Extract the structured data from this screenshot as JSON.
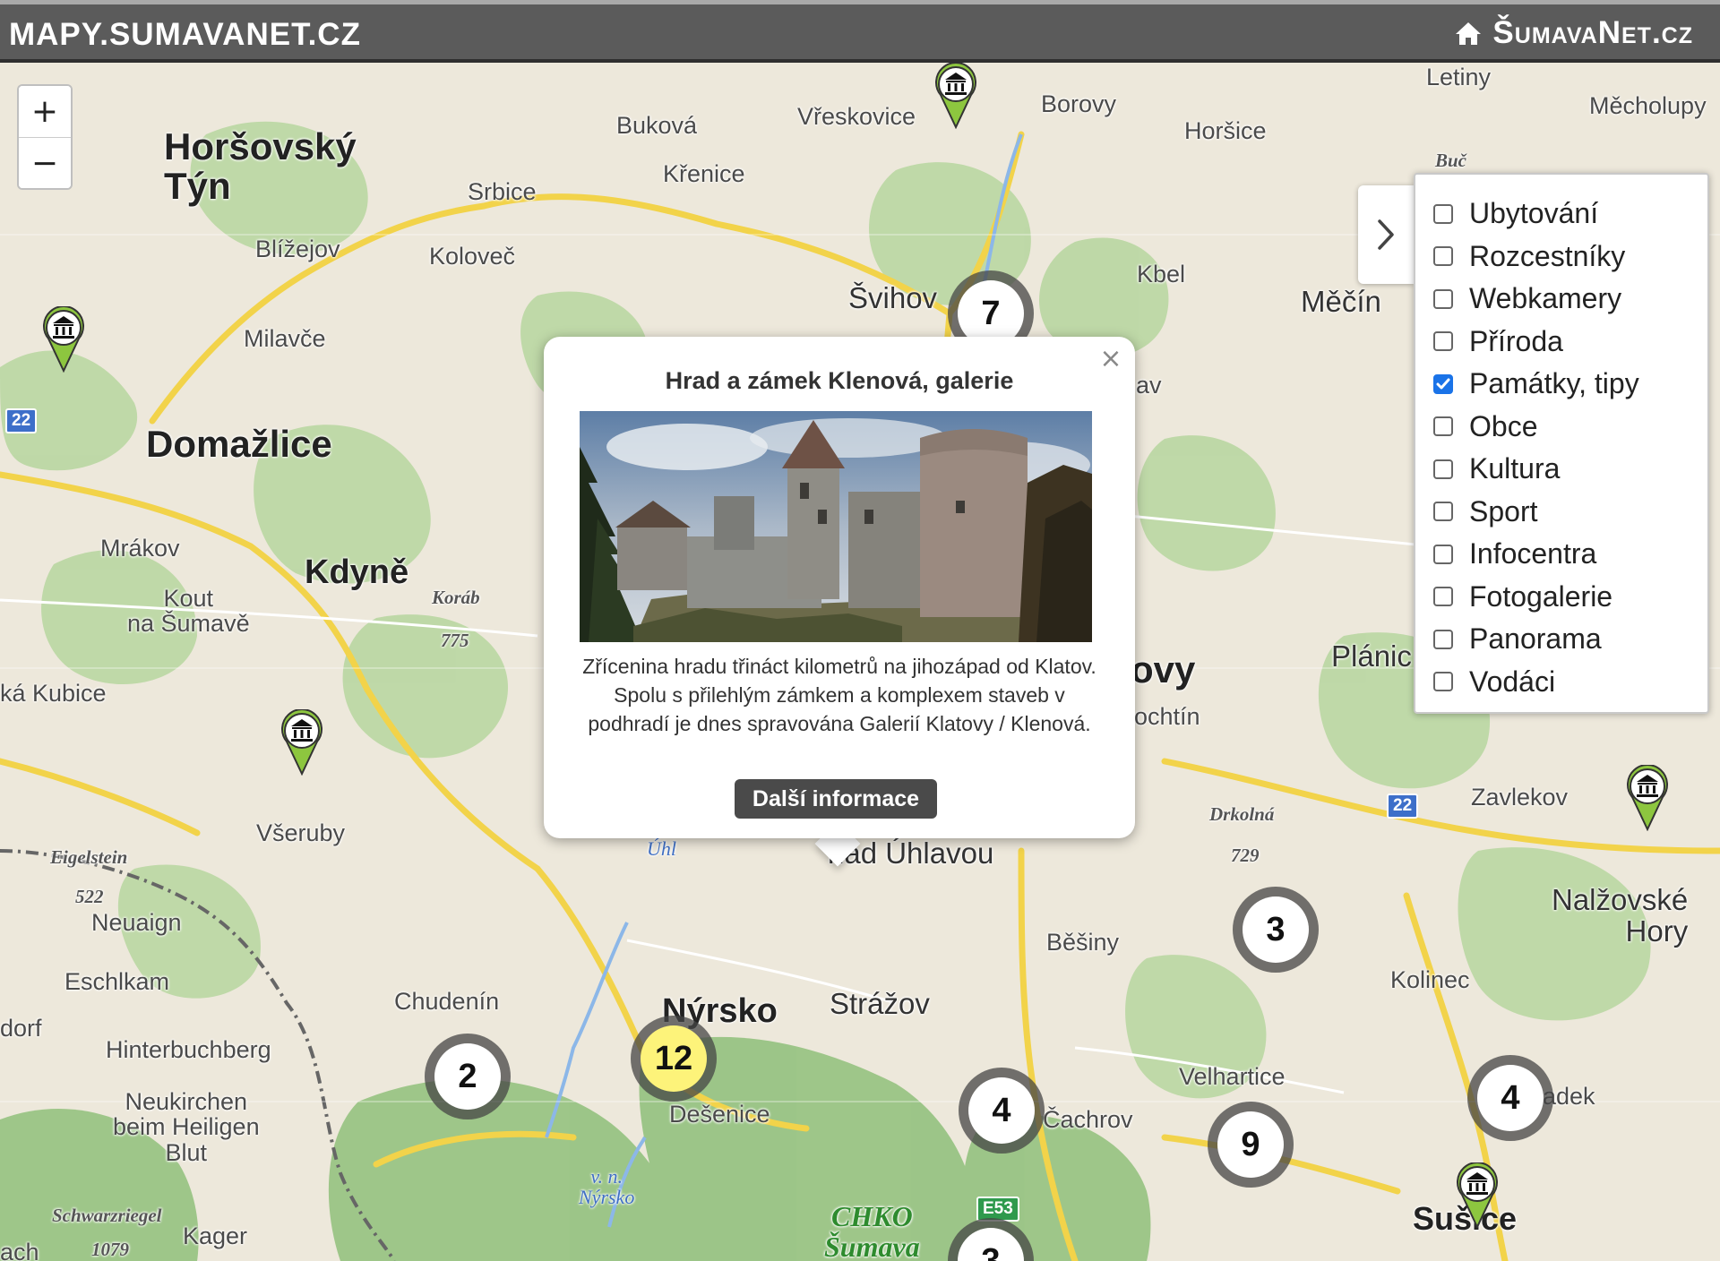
{
  "header": {
    "site_title": "MAPY.SUMAVANET.CZ",
    "home_link": "ŠumavaNet.cz",
    "home_icon": "home-icon"
  },
  "zoom": {
    "in_label": "+",
    "out_label": "−"
  },
  "layers": {
    "toggle_icon": "chevron-right-icon",
    "items": [
      {
        "label": "Ubytování",
        "checked": false
      },
      {
        "label": "Rozcestníky",
        "checked": false
      },
      {
        "label": "Webkamery",
        "checked": false
      },
      {
        "label": "Příroda",
        "checked": false
      },
      {
        "label": "Památky, tipy",
        "checked": true
      },
      {
        "label": "Obce",
        "checked": false
      },
      {
        "label": "Kultura",
        "checked": false
      },
      {
        "label": "Sport",
        "checked": false
      },
      {
        "label": "Infocentra",
        "checked": false
      },
      {
        "label": "Fotogalerie",
        "checked": false
      },
      {
        "label": "Panorama",
        "checked": false
      },
      {
        "label": "Vodáci",
        "checked": false
      }
    ]
  },
  "popup": {
    "title": "Hrad a zámek Klenová, galerie",
    "description": "Zřícenina hradu třináct kilometrů na jihozápad od Klatov. Spolu s přilehlým zámkem a komplexem staveb v podhradí je dnes spravována Galerií Klatovy / Klenová.",
    "button_label": "Další informace",
    "close_label": "×"
  },
  "clusters": [
    "7",
    "3",
    "2",
    "12",
    "4",
    "9",
    "4",
    "3"
  ],
  "map_labels": {
    "horsovsky_tyn": "Horšovský\nTýn",
    "domazlice": "Domažlice",
    "kdyne": "Kdyně",
    "nyrsko": "Nýrsko",
    "susice": "Sušice",
    "bukova": "Buková",
    "vreskovice": "Vřeskovice",
    "borovy": "Borovy",
    "horsice": "Horšice",
    "letiny": "Letiny",
    "mecholupy": "Měcholupy",
    "buc": "Buč",
    "krenice": "Křenice",
    "srbice": "Srbice",
    "blizejov": "Blížejov",
    "kolovec": "Koloveč",
    "svihov": "Švihov",
    "kbel": "Kbel",
    "mecin": "Měčín",
    "milavce": "Milavče",
    "mrakov": "Mrákov",
    "kout": "Kout\nna Šumavě",
    "korab": "Koráb",
    "korab_alt": "775",
    "kubice": "ká Kubice",
    "planice": "Plánic",
    "ovy": "ovy",
    "ochtin": "ochtín",
    "zavlekov": "Zavlekov",
    "drkolna": "Drkolná",
    "drkolna_alt": "729",
    "nad_uhlavou": "nad Úhlavou",
    "vseruby": "Všeruby",
    "eigelstein": "Eigelstein",
    "eigelstein_alt": "522",
    "neuaign": "Neuaign",
    "eschlkam": "Eschlkam",
    "dorf": "dorf",
    "chudenin": "Chudenín",
    "strazov": "Strážov",
    "besiny": "Běšiny",
    "nalzovske": "Nalžovské\nHory",
    "kolinec": "Kolinec",
    "hinterbuchberg": "Hinterbuchberg",
    "neukirchen": "Neukirchen\nbeim Heiligen\nBlut",
    "desenice": "Dešenice",
    "velhartice": "Velhartice",
    "cachrov": "Čachrov",
    "adek": "adek",
    "schwarzriegel": "Schwarzriegel",
    "schwarzriegel_alt": "1079",
    "kager": "Kager",
    "ach": "ach",
    "vn_nyrsko": "v. n.\nNýrsko",
    "chko": "CHKO\nŠumava",
    "uhl": "Úhl",
    "av": "av",
    "road_22a": "22",
    "road_22b": "22",
    "road_e53": "E53"
  },
  "colors": {
    "header_bg": "#5b5b5b",
    "checkbox_accent": "#1a73e8",
    "cluster_highlight": "#fdf37a",
    "marker_green": "#8dc63f",
    "button_dark": "#4a4a4a"
  }
}
